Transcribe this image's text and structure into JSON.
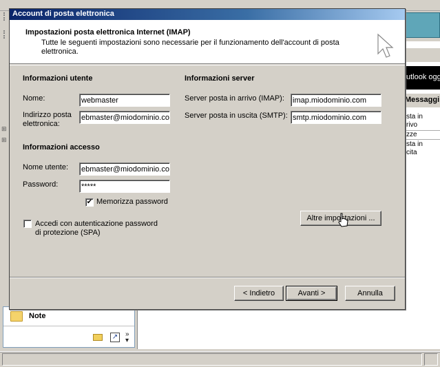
{
  "background": {
    "left_panel": {
      "note_label": "Note"
    },
    "right_strip": {
      "outlook_text": "utlook oggi",
      "messages_header": "Messaggi",
      "items": [
        "sta in",
        "rivo",
        "zze",
        "sta in",
        "cita"
      ]
    }
  },
  "dialog": {
    "title": "Account di posta elettronica",
    "header": {
      "title": "Impostazioni posta elettronica Internet (IMAP)",
      "description": "Tutte le seguenti impostazioni sono necessarie per il funzionamento dell'account di posta elettronica."
    },
    "user_info": {
      "section_title": "Informazioni utente",
      "name_label": "Nome:",
      "name_value": "webmaster",
      "email_label_line1": "Indirizzo posta",
      "email_label_line2": "elettronica:",
      "email_value": "ebmaster@miodominio.com"
    },
    "server_info": {
      "section_title": "Informazioni server",
      "incoming_label": "Server posta in arrivo (IMAP):",
      "incoming_value": "imap.miodominio.com",
      "outgoing_label": "Server posta in uscita (SMTP):",
      "outgoing_value": "smtp.miodominio.com"
    },
    "access_info": {
      "section_title": "Informazioni accesso",
      "username_label": "Nome utente:",
      "username_value": "ebmaster@miodominio.com",
      "password_label": "Password:",
      "password_value": "*****",
      "remember_label": "Memorizza password",
      "remember_checked": true,
      "spa_label_line1": "Accedi con autenticazione password",
      "spa_label_line2": "di protezione (SPA)",
      "spa_checked": false
    },
    "buttons": {
      "more_settings": "Altre impostazioni ...",
      "back": "< Indietro",
      "next": "Avanti >",
      "cancel": "Annulla"
    }
  },
  "colors": {
    "title_bar": "#0a246a",
    "dialog_face": "#d4d0c8",
    "tooltip": "#5fa6b8"
  }
}
